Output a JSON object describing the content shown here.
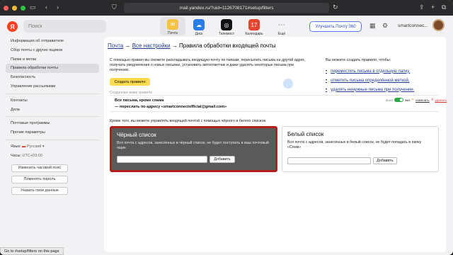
{
  "browser": {
    "url": "mail.yandex.ru/?uid=1126708171#setup/filters",
    "status_url": "Go to #setup/filters on this page"
  },
  "header": {
    "logo": "Я",
    "search_placeholder": "Поиск",
    "apps": [
      {
        "label": "Почта",
        "icon": "mail-icon",
        "color": "#f5c242"
      },
      {
        "label": "Диск",
        "icon": "disk-icon",
        "color": "#2b7de9"
      },
      {
        "label": "Телемост",
        "icon": "telemost-icon",
        "color": "#111111"
      },
      {
        "label": "Календарь",
        "icon": "calendar-icon",
        "color": "#e8452f",
        "badge": "17"
      },
      {
        "label": "Ещё",
        "icon": "more-icon",
        "color": "#888888"
      }
    ],
    "upgrade_label": "Улучшить Почту 360",
    "account_name": "smartconnec..."
  },
  "sidebar": {
    "items": [
      {
        "label": "Информация об отправителе",
        "active": false
      },
      {
        "label": "Сбор почты с других ящиков",
        "active": false
      },
      {
        "label": "Папки и метки",
        "active": false
      },
      {
        "label": "Правила обработки почты",
        "active": true
      },
      {
        "label": "Безопасность",
        "active": false
      },
      {
        "label": "Управление рассылками",
        "active": false
      }
    ],
    "items2": [
      {
        "label": "Контакты"
      },
      {
        "label": "Дела"
      }
    ],
    "items3": [
      {
        "label": "Почтовые программы"
      },
      {
        "label": "Прочие параметры"
      }
    ],
    "lang_label": "Язык:",
    "lang_value": "Русский",
    "time_label": "Часы:",
    "time_value": "UTC+03:00",
    "buttons": [
      "Изменить часовой пояс",
      "Поменять пароль",
      "Указать свои данные"
    ]
  },
  "main": {
    "crumb_mail": "Почта",
    "crumb_sep": "→",
    "crumb_settings": "Все настройки",
    "crumb_current": "Правила обработки входящей почты",
    "intro": "С помощью правил вы сможете раскладывать входящую почту по папкам, пересылать письма на другой адрес, получать уведомления о новых письмах, установить автоответчик и даже удалять некоторые письма при получении.",
    "create_button": "Создать правило",
    "rules_label": "Созданные вами правила",
    "rule_line1": "Все письма, кроме спама",
    "rule_line2": "— переслать по адресу «smartconnectofficial@gmail.com»",
    "rule_off": "выкл",
    "rule_on": "вкл",
    "rule_edit": "изменить",
    "rule_delete": "удалить",
    "right_label": "Вы можете создать правило, чтобы:",
    "right_links": [
      "переместить письма в отдельную папку,",
      "отметить письма определённой меткой,",
      "удалять ненужные письма при получении."
    ],
    "bw_text": "Кроме того, вы можете управлять входящей почтой с помощью чёрного и белого списков.",
    "blacklist_title": "Чёрный список",
    "blacklist_desc": "Вся почта с адресов, занесённых в чёрный список, не будет поступать в ваш почтовый ящик.",
    "blacklist_add": "Добавить",
    "whitelist_title": "Белый список",
    "whitelist_desc": "Вся почта с адресов, занесённых в белый список, не будет попадать в папку «Спам»",
    "whitelist_add": "Добавить"
  }
}
